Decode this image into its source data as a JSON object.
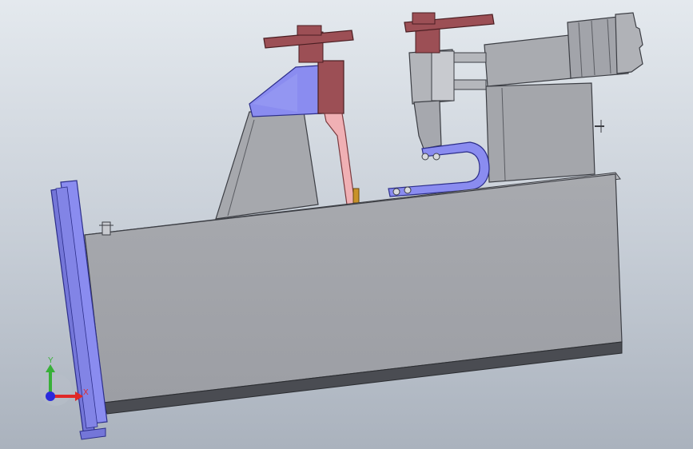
{
  "triad": {
    "y_label": "Y",
    "x_label": "X"
  },
  "colors": {
    "background_top": "#e4e9ee",
    "background_bottom": "#aab2bd",
    "body_gray": "#a3a5ab",
    "body_edge": "#4a4c52",
    "blue_part": "#8a8cf0",
    "clamp_handle": "#9c4f55",
    "pink_arm": "#f0b0b4",
    "gold_pin": "#c8922a",
    "triad_y": "#38b038",
    "triad_x": "#e02828",
    "triad_z": "#2a2adc"
  }
}
